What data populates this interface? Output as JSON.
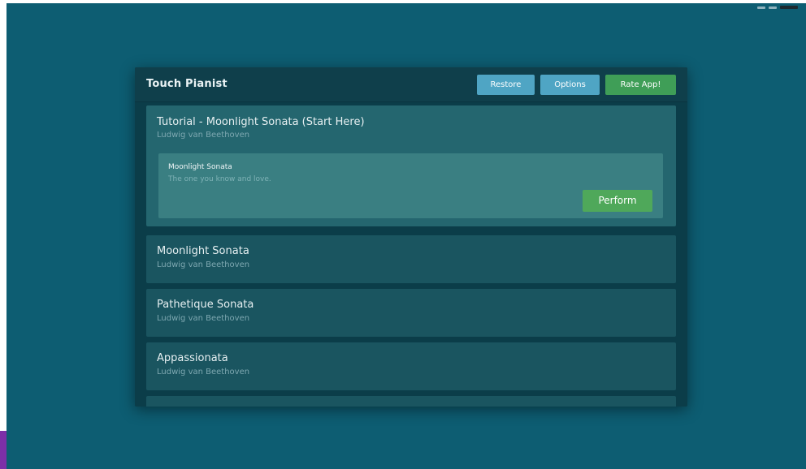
{
  "app": {
    "title": "Touch Pianist",
    "buttons": {
      "restore": "Restore",
      "options": "Options",
      "rate": "Rate App!"
    }
  },
  "songs": [
    {
      "title": "Tutorial - Moonlight Sonata (Start Here)",
      "artist": "Ludwig van Beethoven",
      "expanded": true,
      "pieces": [
        {
          "title": "Moonlight Sonata",
          "description": "The one you know and love.",
          "action": "Perform"
        }
      ]
    },
    {
      "title": "Moonlight Sonata",
      "artist": "Ludwig van Beethoven"
    },
    {
      "title": "Pathetique Sonata",
      "artist": "Ludwig van Beethoven"
    },
    {
      "title": "Appassionata",
      "artist": "Ludwig van Beethoven"
    },
    {
      "title": "",
      "artist": ""
    }
  ],
  "colors": {
    "background": "#0d5d72",
    "panel": "#0b3d49",
    "blue_button": "#4fa5c4",
    "green_button": "#3f9e57"
  }
}
